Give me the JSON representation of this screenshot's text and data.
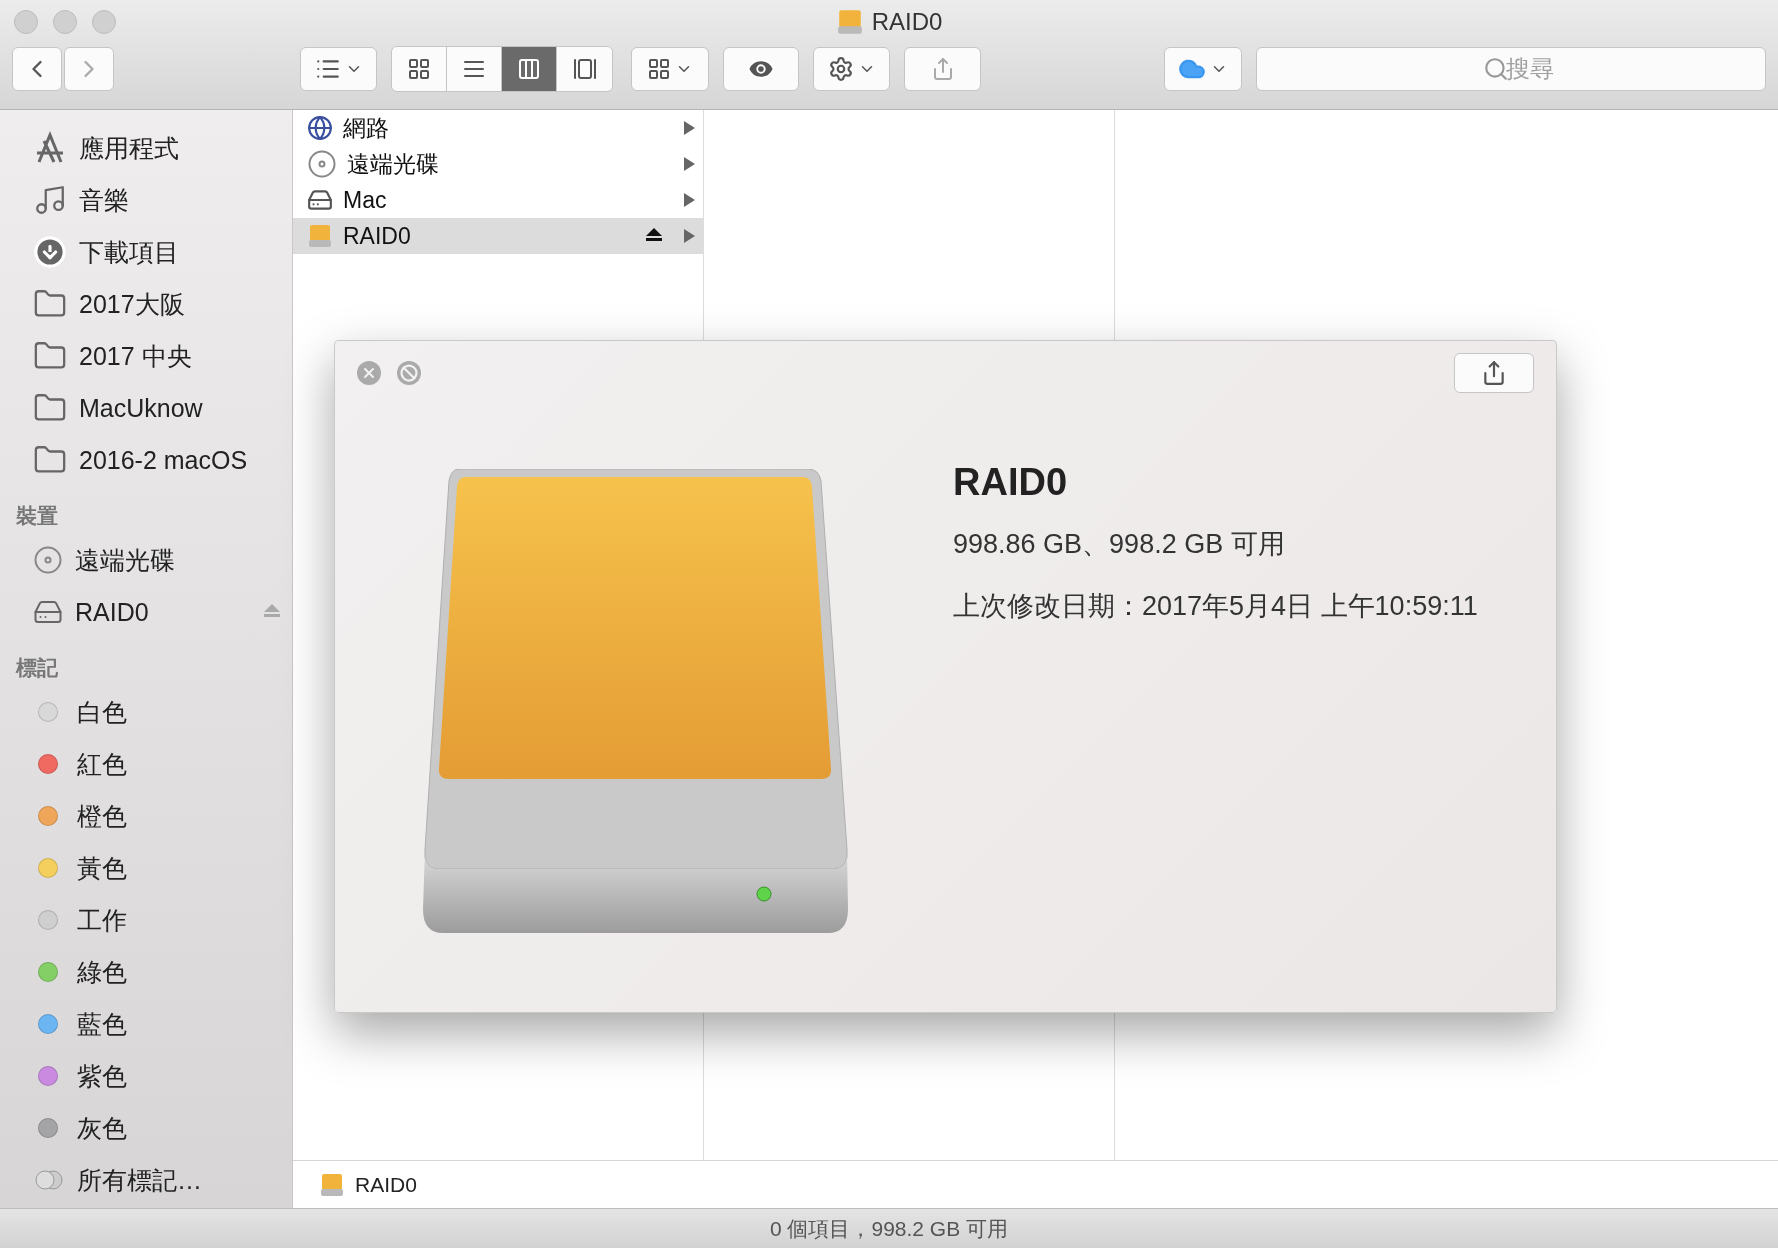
{
  "window": {
    "title": "RAID0"
  },
  "toolbar": {
    "view_modes": [
      {
        "selected": false
      },
      {
        "selected": false
      },
      {
        "selected": true
      },
      {
        "selected": false
      }
    ],
    "search": {
      "placeholder": "搜尋"
    }
  },
  "sidebar": {
    "favorites": [
      {
        "label": "應用程式",
        "kind": "apps"
      },
      {
        "label": "音樂",
        "kind": "music"
      },
      {
        "label": "下載項目",
        "kind": "downloads"
      },
      {
        "label": "2017大阪",
        "kind": "folder"
      },
      {
        "label": "2017 中央",
        "kind": "folder"
      },
      {
        "label": "MacUknow",
        "kind": "folder"
      },
      {
        "label": "2016-2 macOS",
        "kind": "folder"
      }
    ],
    "devices": {
      "heading": "裝置",
      "items": [
        {
          "label": "遠端光碟",
          "kind": "disc",
          "ejectable": false
        },
        {
          "label": "RAID0",
          "kind": "drive",
          "ejectable": true
        }
      ]
    },
    "tags": {
      "heading": "標記",
      "items": [
        {
          "label": "白色",
          "kind": "tag",
          "color": "#d8d8d8"
        },
        {
          "label": "紅色",
          "kind": "tag",
          "color": "#f06a62"
        },
        {
          "label": "橙色",
          "kind": "tag",
          "color": "#f0a65a"
        },
        {
          "label": "黃色",
          "kind": "tag",
          "color": "#f5cf5e"
        },
        {
          "label": "工作",
          "kind": "tag",
          "color": "#cfcfcf"
        },
        {
          "label": "綠色",
          "kind": "tag",
          "color": "#84cf66"
        },
        {
          "label": "藍色",
          "kind": "tag",
          "color": "#6bb5f3"
        },
        {
          "label": "紫色",
          "kind": "tag",
          "color": "#c98ae0"
        },
        {
          "label": "灰色",
          "kind": "tag",
          "color": "#a4a4a6"
        },
        {
          "label": "所有標記…",
          "kind": "all"
        }
      ]
    }
  },
  "columns": [
    {
      "items": [
        {
          "label": "網路",
          "kind": "network",
          "selected": false,
          "ejectable": false
        },
        {
          "label": "遠端光碟",
          "kind": "disc",
          "selected": false,
          "ejectable": false
        },
        {
          "label": "Mac",
          "kind": "hdd",
          "selected": false,
          "ejectable": false
        },
        {
          "label": "RAID0",
          "kind": "drive",
          "selected": true,
          "ejectable": true
        }
      ]
    }
  ],
  "quick_look": {
    "title": "RAID0",
    "capacity": "998.86 GB、998.2 GB 可用",
    "modified": "上次修改日期：2017年5月4日 上午10:59:11"
  },
  "path_bar": [
    {
      "label": "RAID0"
    }
  ],
  "status_bar": "0 個項目，998.2 GB 可用"
}
